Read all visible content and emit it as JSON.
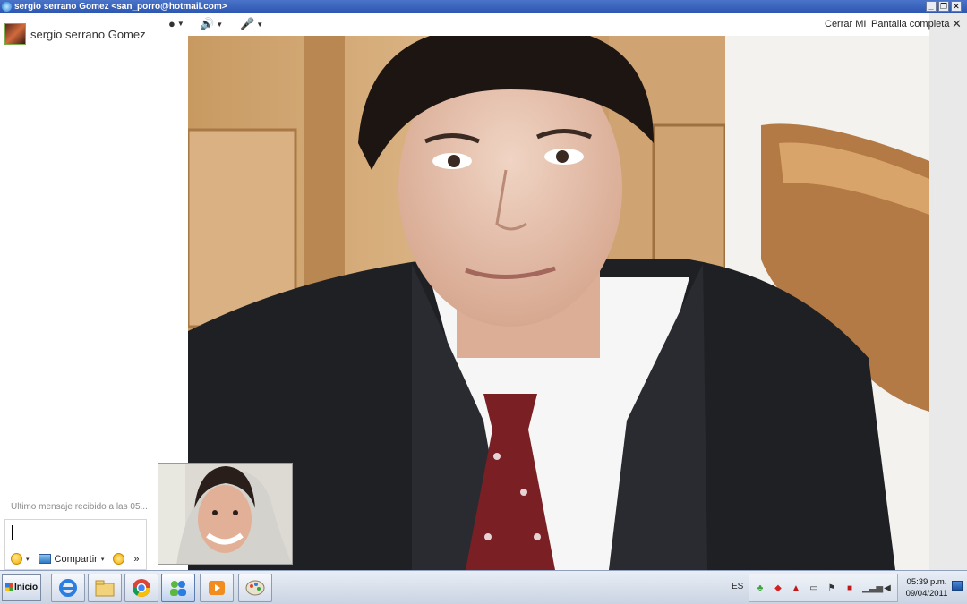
{
  "window": {
    "title": "sergio serrano Gomez <san_porro@hotmail.com>"
  },
  "contact": {
    "name": "sergio serrano Gomez"
  },
  "chat": {
    "last_message": "Último mensaje recibido a las 05...",
    "share_label": "Compartir",
    "more_label": "»"
  },
  "video_toolbar": {
    "close_label": "Cerrar MI",
    "fullscreen_label": "Pantalla completa",
    "close_icon": "✕"
  },
  "taskbar": {
    "start_label": "Inicio",
    "apps": [
      "internet-explorer-icon",
      "file-explorer-icon",
      "chrome-icon",
      "messenger-icon",
      "media-player-icon",
      "paint-icon"
    ],
    "language": "ES",
    "clock_time": "05:39 p.m.",
    "clock_date": "09/04/2011"
  },
  "colors": {
    "titlebar": "#2c55b0",
    "taskbar": "#c9d3e2"
  }
}
